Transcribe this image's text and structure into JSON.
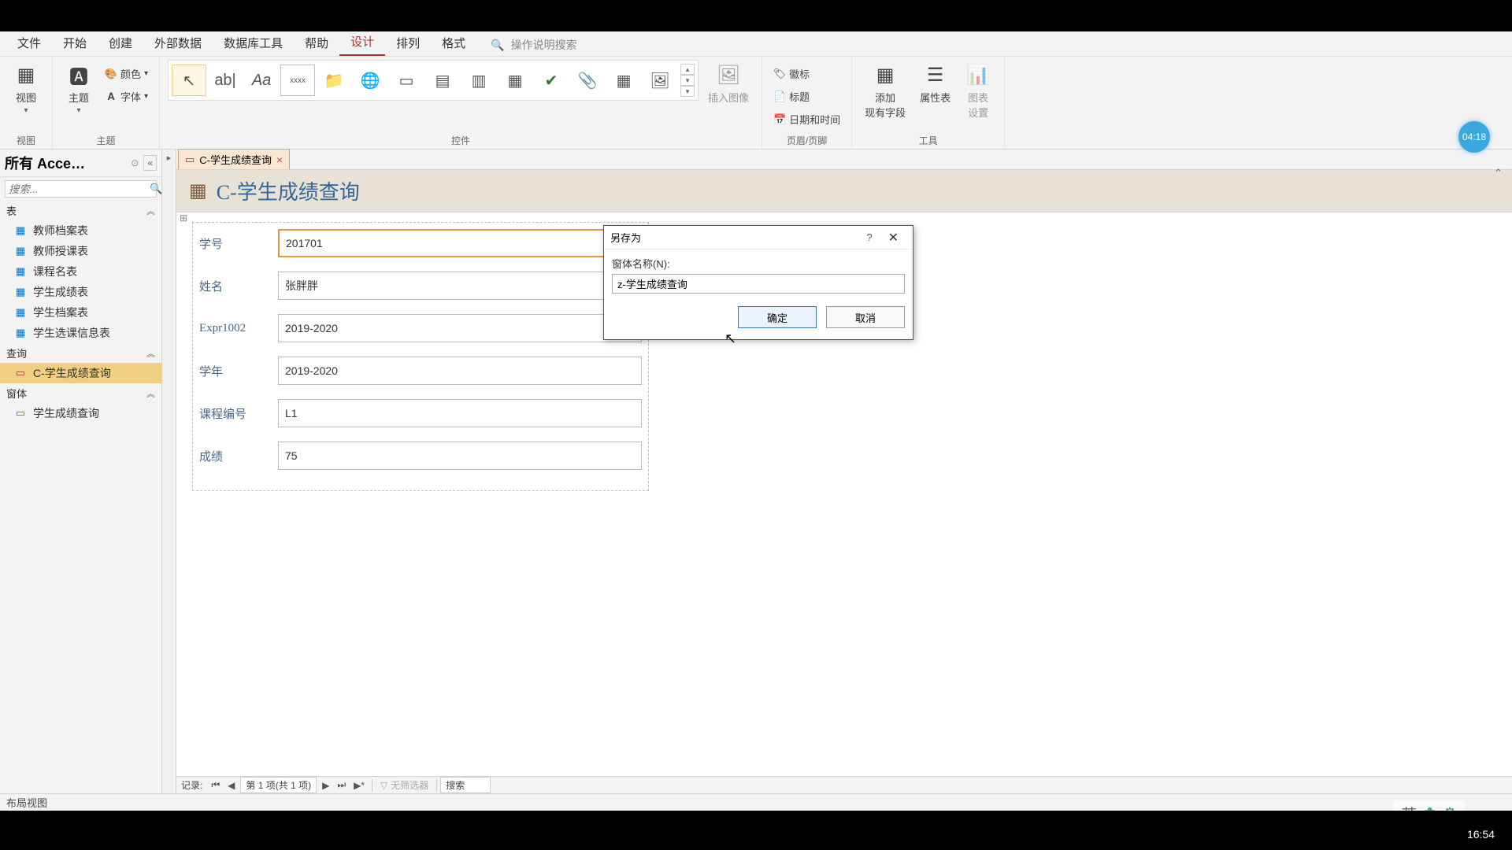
{
  "tabs": {
    "file": "文件",
    "home": "开始",
    "create": "创建",
    "external": "外部数据",
    "dbtools": "数据库工具",
    "help": "帮助",
    "design": "设计",
    "arrange": "排列",
    "format": "格式",
    "search_placeholder": "操作说明搜索"
  },
  "ribbon": {
    "view_label": "视图",
    "view_group": "视图",
    "themes_label": "主题",
    "colors_label": "颜色",
    "fonts_label": "字体",
    "themes_group": "主题",
    "controls_group": "控件",
    "insert_image_label": "插入图像",
    "logo_label": "徽标",
    "title_label": "标题",
    "datetime_label": "日期和时间",
    "header_group": "页眉/页脚",
    "addfield_label": "添加\n现有字段",
    "propsheet_label": "属性表",
    "chart_label": "图表\n设置",
    "tools_group": "工具"
  },
  "nav": {
    "title": "所有 Acce…",
    "search_placeholder": "搜索...",
    "grp_tables": "表",
    "grp_queries": "查询",
    "grp_forms": "窗体",
    "tables": [
      "教师档案表",
      "教师授课表",
      "课程名表",
      "学生成绩表",
      "学生档案表",
      "学生选课信息表"
    ],
    "queries": [
      "C-学生成绩查询"
    ],
    "forms": [
      "学生成绩查询"
    ]
  },
  "doc": {
    "tab_label": "C-学生成绩查询",
    "header_title": "C-学生成绩查询",
    "fields": [
      {
        "label": "学号",
        "value": "201701"
      },
      {
        "label": "姓名",
        "value": "张胖胖"
      },
      {
        "label": "Expr1002",
        "value": "2019-2020"
      },
      {
        "label": "学年",
        "value": "2019-2020"
      },
      {
        "label": "课程编号",
        "value": "L1"
      },
      {
        "label": "成绩",
        "value": "75"
      }
    ],
    "record_label": "记录:",
    "record_counter": "第 1 项(共 1 项)",
    "no_filter": "无筛选器",
    "search_label": "搜索"
  },
  "dialog": {
    "title": "另存为",
    "field_label": "窗体名称(N):",
    "field_value": "z-学生成绩查询",
    "ok": "确定",
    "cancel": "取消"
  },
  "status": {
    "view": "布局视图",
    "ime": "英"
  },
  "badge": "04:18",
  "taskbar_time": "16:54"
}
